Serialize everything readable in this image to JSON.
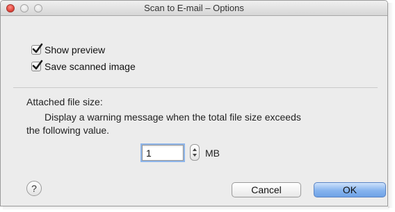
{
  "window": {
    "title": "Scan to E-mail – Options"
  },
  "options": {
    "show_preview": {
      "label": "Show preview",
      "checked": true
    },
    "save_scanned_image": {
      "label": "Save scanned image",
      "checked": true
    }
  },
  "file_size": {
    "title": "Attached file size:",
    "description_line1": "Display a warning message when the total file size exceeds",
    "description_line2": "the following value.",
    "value": "1",
    "unit": "MB"
  },
  "buttons": {
    "help": "?",
    "cancel": "Cancel",
    "ok": "OK"
  },
  "colors": {
    "accent": "#86b4ee",
    "close": "#e2463c"
  }
}
